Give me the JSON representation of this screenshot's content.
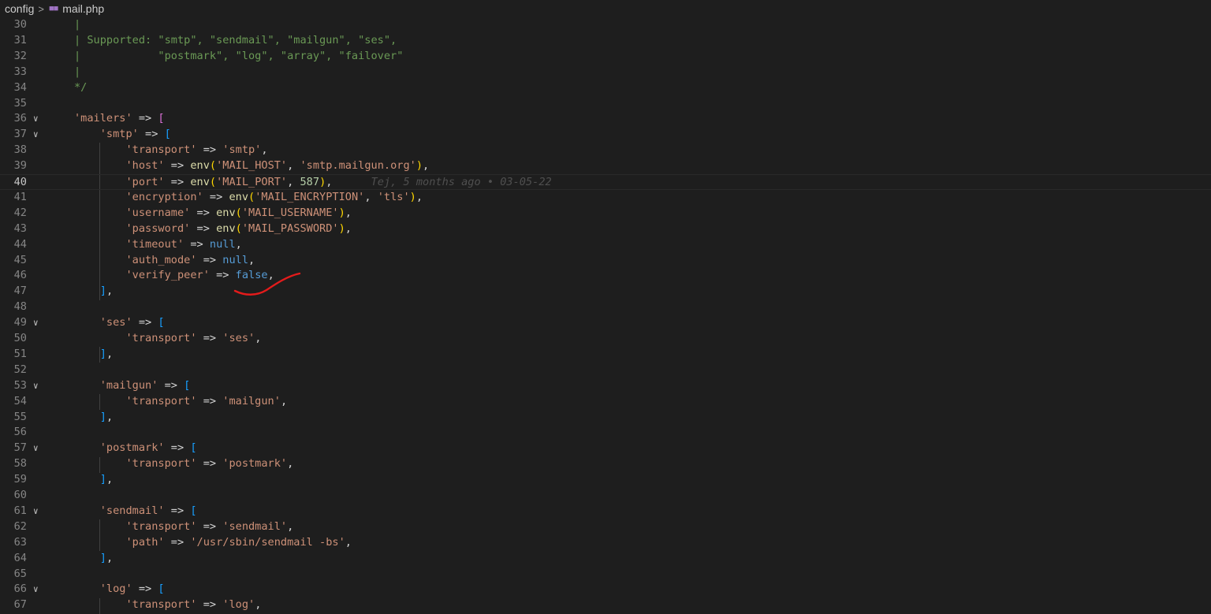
{
  "breadcrumb": {
    "folder": "config",
    "separator": ">",
    "file_icon": "php-elephant-icon",
    "file": "mail.php"
  },
  "blame": "Tej, 5 months ago • 03-05-22",
  "lines": [
    {
      "num": "30",
      "fold": "",
      "tokens": [
        [
          "com",
          "|"
        ]
      ]
    },
    {
      "num": "31",
      "fold": "",
      "tokens": [
        [
          "com",
          "| Supported: \"smtp\", \"sendmail\", \"mailgun\", \"ses\","
        ]
      ]
    },
    {
      "num": "32",
      "fold": "",
      "tokens": [
        [
          "com",
          "|            \"postmark\", \"log\", \"array\", \"failover\""
        ]
      ]
    },
    {
      "num": "33",
      "fold": "",
      "tokens": [
        [
          "com",
          "|"
        ]
      ]
    },
    {
      "num": "34",
      "fold": "",
      "tokens": [
        [
          "com",
          "*/"
        ]
      ]
    },
    {
      "num": "35",
      "fold": "",
      "tokens": []
    },
    {
      "num": "36",
      "fold": "v",
      "tokens": [
        [
          "str",
          "'mailers'"
        ],
        [
          "op",
          " => "
        ],
        [
          "b1",
          "["
        ]
      ]
    },
    {
      "num": "37",
      "fold": "v",
      "tokens": [
        [
          "op",
          "    "
        ],
        [
          "str",
          "'smtp'"
        ],
        [
          "op",
          " => "
        ],
        [
          "b2",
          "["
        ]
      ]
    },
    {
      "num": "38",
      "fold": "",
      "tokens": [
        [
          "op",
          "        "
        ],
        [
          "str",
          "'transport'"
        ],
        [
          "op",
          " => "
        ],
        [
          "str",
          "'smtp'"
        ],
        [
          "op",
          ","
        ]
      ]
    },
    {
      "num": "39",
      "fold": "",
      "tokens": [
        [
          "op",
          "        "
        ],
        [
          "str",
          "'host'"
        ],
        [
          "op",
          " => "
        ],
        [
          "fn",
          "env"
        ],
        [
          "b3",
          "("
        ],
        [
          "str",
          "'MAIL_HOST'"
        ],
        [
          "op",
          ", "
        ],
        [
          "str",
          "'smtp.mailgun.org'"
        ],
        [
          "b3",
          ")"
        ],
        [
          "op",
          ","
        ]
      ]
    },
    {
      "num": "40",
      "fold": "",
      "current": true,
      "tokens": [
        [
          "op",
          "        "
        ],
        [
          "str",
          "'port'"
        ],
        [
          "op",
          " => "
        ],
        [
          "fn",
          "env"
        ],
        [
          "b3",
          "("
        ],
        [
          "str",
          "'MAIL_PORT'"
        ],
        [
          "op",
          ", "
        ],
        [
          "num",
          "587"
        ],
        [
          "b3",
          ")"
        ],
        [
          "op",
          ","
        ]
      ]
    },
    {
      "num": "41",
      "fold": "",
      "tokens": [
        [
          "op",
          "        "
        ],
        [
          "str",
          "'encryption'"
        ],
        [
          "op",
          " => "
        ],
        [
          "fn",
          "env"
        ],
        [
          "b3",
          "("
        ],
        [
          "str",
          "'MAIL_ENCRYPTION'"
        ],
        [
          "op",
          ", "
        ],
        [
          "str",
          "'tls'"
        ],
        [
          "b3",
          ")"
        ],
        [
          "op",
          ","
        ]
      ]
    },
    {
      "num": "42",
      "fold": "",
      "tokens": [
        [
          "op",
          "        "
        ],
        [
          "str",
          "'username'"
        ],
        [
          "op",
          " => "
        ],
        [
          "fn",
          "env"
        ],
        [
          "b3",
          "("
        ],
        [
          "str",
          "'MAIL_USERNAME'"
        ],
        [
          "b3",
          ")"
        ],
        [
          "op",
          ","
        ]
      ]
    },
    {
      "num": "43",
      "fold": "",
      "tokens": [
        [
          "op",
          "        "
        ],
        [
          "str",
          "'password'"
        ],
        [
          "op",
          " => "
        ],
        [
          "fn",
          "env"
        ],
        [
          "b3",
          "("
        ],
        [
          "str",
          "'MAIL_PASSWORD'"
        ],
        [
          "b3",
          ")"
        ],
        [
          "op",
          ","
        ]
      ]
    },
    {
      "num": "44",
      "fold": "",
      "tokens": [
        [
          "op",
          "        "
        ],
        [
          "str",
          "'timeout'"
        ],
        [
          "op",
          " => "
        ],
        [
          "kw",
          "null"
        ],
        [
          "op",
          ","
        ]
      ]
    },
    {
      "num": "45",
      "fold": "",
      "tokens": [
        [
          "op",
          "        "
        ],
        [
          "str",
          "'auth_mode'"
        ],
        [
          "op",
          " => "
        ],
        [
          "kw",
          "null"
        ],
        [
          "op",
          ","
        ]
      ]
    },
    {
      "num": "46",
      "fold": "",
      "tokens": [
        [
          "op",
          "        "
        ],
        [
          "str",
          "'verify_peer'"
        ],
        [
          "op",
          " => "
        ],
        [
          "kw",
          "false"
        ],
        [
          "op",
          ","
        ]
      ]
    },
    {
      "num": "47",
      "fold": "",
      "tokens": [
        [
          "op",
          "    "
        ],
        [
          "b2",
          "]"
        ],
        [
          "op",
          ","
        ]
      ]
    },
    {
      "num": "48",
      "fold": "",
      "tokens": []
    },
    {
      "num": "49",
      "fold": "v",
      "tokens": [
        [
          "op",
          "    "
        ],
        [
          "str",
          "'ses'"
        ],
        [
          "op",
          " => "
        ],
        [
          "b2",
          "["
        ]
      ]
    },
    {
      "num": "50",
      "fold": "",
      "tokens": [
        [
          "op",
          "        "
        ],
        [
          "str",
          "'transport'"
        ],
        [
          "op",
          " => "
        ],
        [
          "str",
          "'ses'"
        ],
        [
          "op",
          ","
        ]
      ]
    },
    {
      "num": "51",
      "fold": "",
      "tokens": [
        [
          "op",
          "    "
        ],
        [
          "b2",
          "]"
        ],
        [
          "op",
          ","
        ]
      ]
    },
    {
      "num": "52",
      "fold": "",
      "tokens": []
    },
    {
      "num": "53",
      "fold": "v",
      "tokens": [
        [
          "op",
          "    "
        ],
        [
          "str",
          "'mailgun'"
        ],
        [
          "op",
          " => "
        ],
        [
          "b2",
          "["
        ]
      ]
    },
    {
      "num": "54",
      "fold": "",
      "tokens": [
        [
          "op",
          "        "
        ],
        [
          "str",
          "'transport'"
        ],
        [
          "op",
          " => "
        ],
        [
          "str",
          "'mailgun'"
        ],
        [
          "op",
          ","
        ]
      ]
    },
    {
      "num": "55",
      "fold": "",
      "tokens": [
        [
          "op",
          "    "
        ],
        [
          "b2",
          "]"
        ],
        [
          "op",
          ","
        ]
      ]
    },
    {
      "num": "56",
      "fold": "",
      "tokens": []
    },
    {
      "num": "57",
      "fold": "v",
      "tokens": [
        [
          "op",
          "    "
        ],
        [
          "str",
          "'postmark'"
        ],
        [
          "op",
          " => "
        ],
        [
          "b2",
          "["
        ]
      ]
    },
    {
      "num": "58",
      "fold": "",
      "tokens": [
        [
          "op",
          "        "
        ],
        [
          "str",
          "'transport'"
        ],
        [
          "op",
          " => "
        ],
        [
          "str",
          "'postmark'"
        ],
        [
          "op",
          ","
        ]
      ]
    },
    {
      "num": "59",
      "fold": "",
      "tokens": [
        [
          "op",
          "    "
        ],
        [
          "b2",
          "]"
        ],
        [
          "op",
          ","
        ]
      ]
    },
    {
      "num": "60",
      "fold": "",
      "tokens": []
    },
    {
      "num": "61",
      "fold": "v",
      "tokens": [
        [
          "op",
          "    "
        ],
        [
          "str",
          "'sendmail'"
        ],
        [
          "op",
          " => "
        ],
        [
          "b2",
          "["
        ]
      ]
    },
    {
      "num": "62",
      "fold": "",
      "tokens": [
        [
          "op",
          "        "
        ],
        [
          "str",
          "'transport'"
        ],
        [
          "op",
          " => "
        ],
        [
          "str",
          "'sendmail'"
        ],
        [
          "op",
          ","
        ]
      ]
    },
    {
      "num": "63",
      "fold": "",
      "tokens": [
        [
          "op",
          "        "
        ],
        [
          "str",
          "'path'"
        ],
        [
          "op",
          " => "
        ],
        [
          "str",
          "'/usr/sbin/sendmail -bs'"
        ],
        [
          "op",
          ","
        ]
      ]
    },
    {
      "num": "64",
      "fold": "",
      "tokens": [
        [
          "op",
          "    "
        ],
        [
          "b2",
          "]"
        ],
        [
          "op",
          ","
        ]
      ]
    },
    {
      "num": "65",
      "fold": "",
      "tokens": []
    },
    {
      "num": "66",
      "fold": "v",
      "tokens": [
        [
          "op",
          "    "
        ],
        [
          "str",
          "'log'"
        ],
        [
          "op",
          " => "
        ],
        [
          "b2",
          "["
        ]
      ]
    },
    {
      "num": "67",
      "fold": "",
      "tokens": [
        [
          "op",
          "        "
        ],
        [
          "str",
          "'transport'"
        ],
        [
          "op",
          " => "
        ],
        [
          "str",
          "'log'"
        ],
        [
          "op",
          ","
        ]
      ]
    }
  ]
}
